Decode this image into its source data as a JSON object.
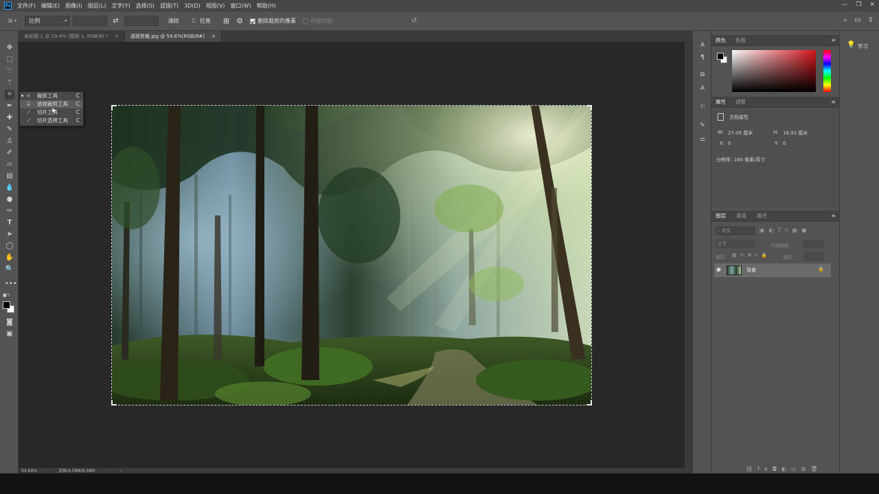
{
  "menubar": {
    "logo": "Ps",
    "items": [
      "文件(F)",
      "编辑(E)",
      "图像(I)",
      "图层(L)",
      "文字(Y)",
      "选择(S)",
      "滤镜(T)",
      "3D(D)",
      "视图(V)",
      "窗口(W)",
      "帮助(H)"
    ]
  },
  "options": {
    "ratio_select": "比例",
    "clear_button": "清除",
    "straighten_button": "拉直",
    "delete_cropped_label": "删除裁剪的像素",
    "content_aware_label": "内容识别"
  },
  "tabs": [
    {
      "label": "未标题-1 @ 19.4% (图层 1, RGB/8) *",
      "close": "×"
    },
    {
      "label": "透视剪裁.jpg @ 54.6%(RGB/8#)",
      "close": "×"
    }
  ],
  "flyout": [
    {
      "label": "裁剪工具",
      "key": "C"
    },
    {
      "label": "透视裁剪工具",
      "key": "C"
    },
    {
      "label": "切片工具",
      "key": "C"
    },
    {
      "label": "切片选择工具",
      "key": "C"
    }
  ],
  "status": {
    "zoom": "54.64%",
    "doc": "文档:6.59M/6.59M"
  },
  "color_panel": {
    "tabs": [
      "颜色",
      "色板"
    ],
    "hue_color": "#d4151c"
  },
  "properties_panel": {
    "tabs": [
      "属性",
      "调整"
    ],
    "title": "文档属性",
    "w_label": "W:",
    "w_value": "27.09 厘米",
    "h_label": "H:",
    "h_value": "16.93 厘米",
    "x_label": "X:",
    "x_value": "0",
    "y_label": "Y:",
    "y_value": "0",
    "resolution": "分辨率: 180 像素/英寸"
  },
  "layers_panel": {
    "tabs": [
      "图层",
      "通道",
      "路径"
    ],
    "search_placeholder": "类型",
    "blend_mode": "正常",
    "opacity_label": "不透明度:",
    "lock_label": "锁定:",
    "fill_label": "填充:",
    "layer_name": "背景"
  },
  "learn_panel": {
    "label": "学习"
  }
}
